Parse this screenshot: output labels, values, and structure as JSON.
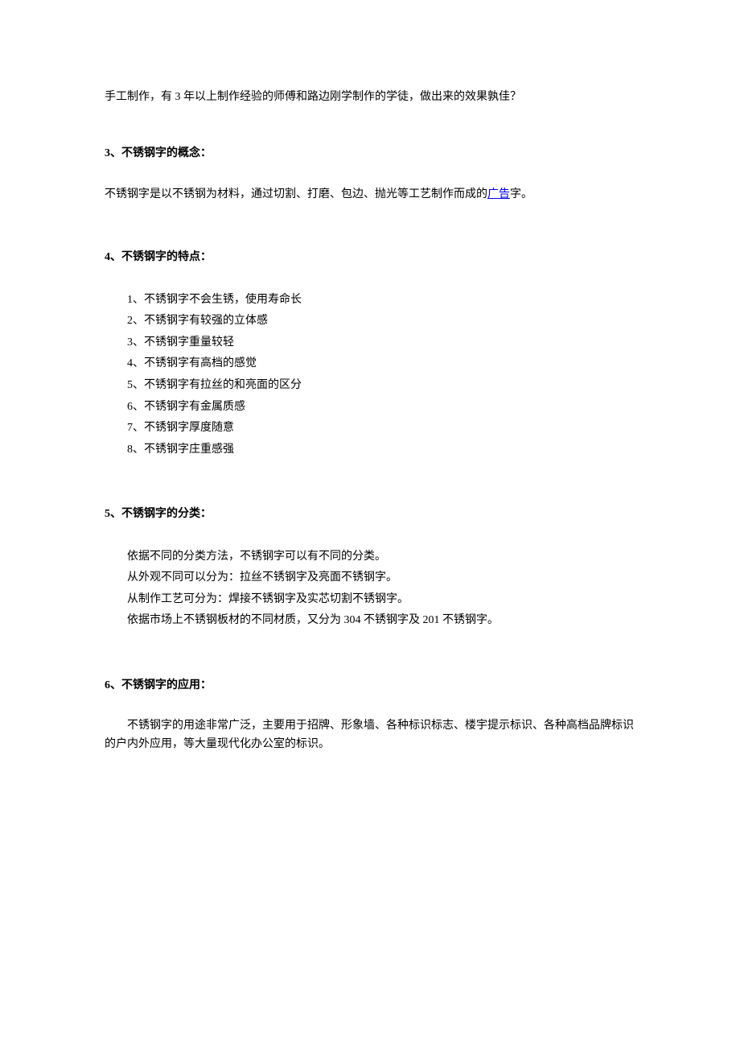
{
  "para1": "手工制作，有 3 年以上制作经验的师傅和路边刚学制作的学徒，做出来的效果孰佳？",
  "section3": {
    "heading": "3、不锈钢字的概念：",
    "text_before_link": "不锈钢字是以不锈钢为材料，通过切割、打磨、包边、抛光等工艺制作而成的",
    "link_text": "广告",
    "text_after_link": "字。"
  },
  "section4": {
    "heading": "4、不锈钢字的特点：",
    "items": [
      "1、不锈钢字不会生锈，使用寿命长",
      "2、不锈钢字有较强的立体感",
      "3、不锈钢字重量较轻",
      "4、不锈钢字有高档的感觉",
      "5、不锈钢字有拉丝的和亮面的区分",
      "6、不锈钢字有金属质感",
      "7、不锈钢字厚度随意",
      "8、不锈钢字庄重感强"
    ]
  },
  "section5": {
    "heading": "5、不锈钢字的分类：",
    "lines": [
      "依据不同的分类方法，不锈钢字可以有不同的分类。",
      "从外观不同可以分为：拉丝不锈钢字及亮面不锈钢字。",
      "从制作工艺可分为：焊接不锈钢字及实芯切割不锈钢字。",
      "依据市场上不锈钢板材的不同材质，又分为 304 不锈钢字及 201 不锈钢字。"
    ]
  },
  "section6": {
    "heading": "6、不锈钢字的应用：",
    "text": "不锈钢字的用途非常广泛，主要用于招牌、形象墙、各种标识标志、楼宇提示标识、各种高档品牌标识的户内外应用，等大量现代化办公室的标识。"
  }
}
